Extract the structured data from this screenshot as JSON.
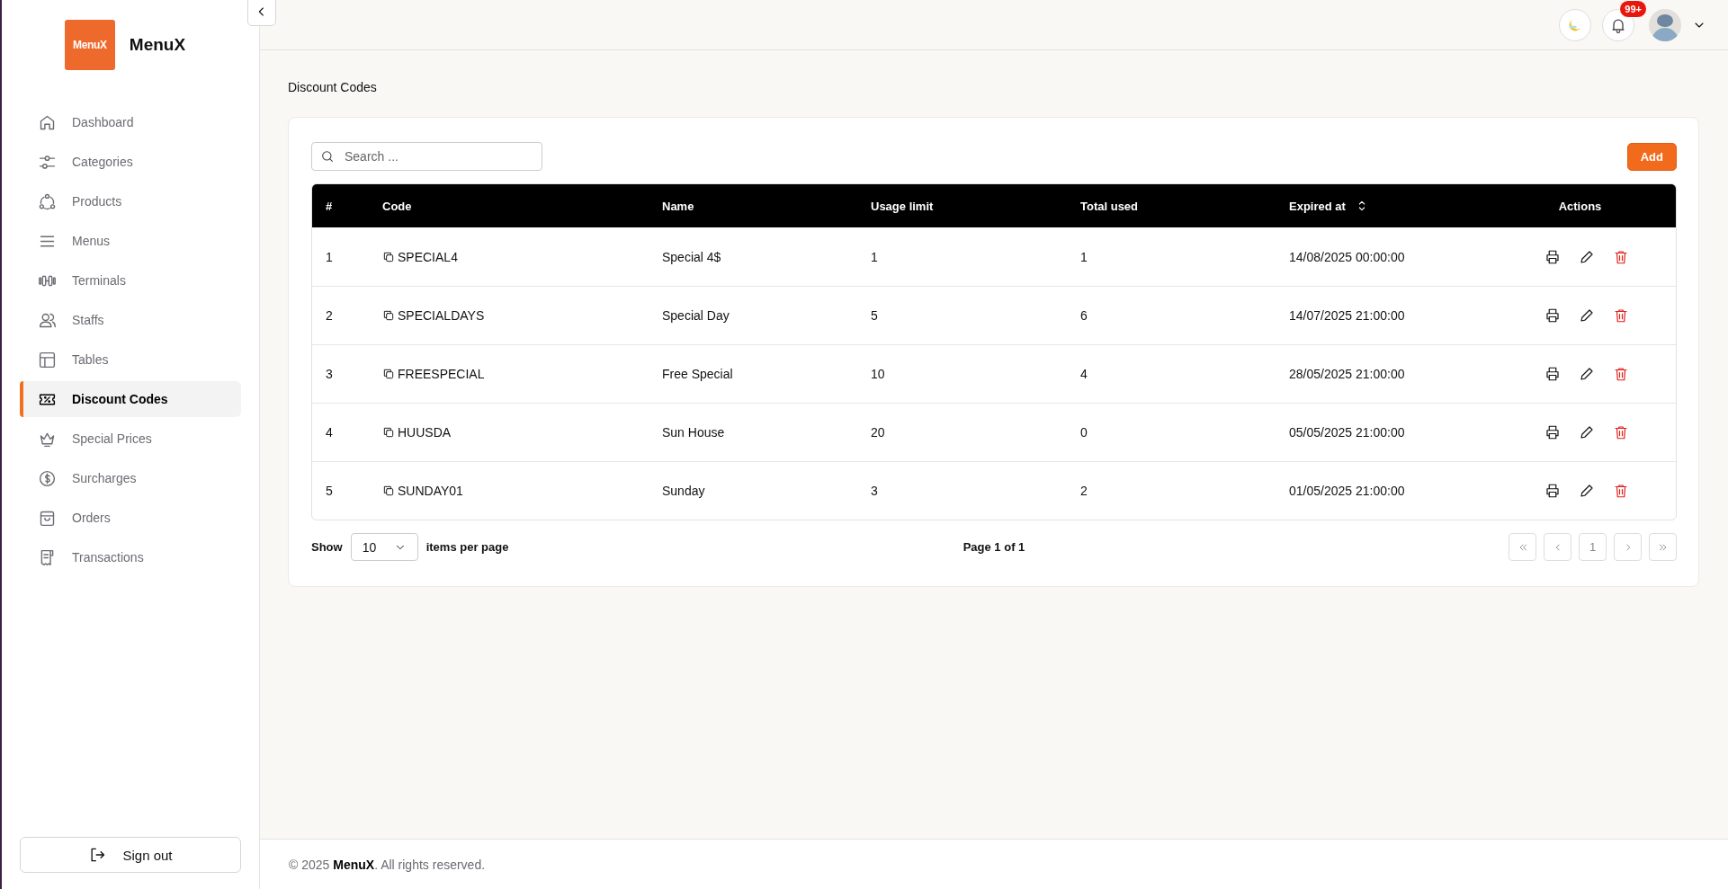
{
  "sidebar": {
    "logo_text": "MenuX",
    "brand": "MenuX",
    "items": [
      {
        "label": "Dashboard",
        "kind": "dashboard",
        "selected": false
      },
      {
        "label": "Categories",
        "kind": "categories",
        "selected": false
      },
      {
        "label": "Products",
        "kind": "products",
        "selected": false
      },
      {
        "label": "Menus",
        "kind": "menus",
        "selected": false
      },
      {
        "label": "Terminals",
        "kind": "terminals",
        "selected": false
      },
      {
        "label": "Staffs",
        "kind": "staffs",
        "selected": false
      },
      {
        "label": "Tables",
        "kind": "tables",
        "selected": false
      },
      {
        "label": "Discount Codes",
        "kind": "discounts",
        "selected": true
      },
      {
        "label": "Special Prices",
        "kind": "special",
        "selected": false
      },
      {
        "label": "Surcharges",
        "kind": "surcharges",
        "selected": false
      },
      {
        "label": "Orders",
        "kind": "orders",
        "selected": false
      },
      {
        "label": "Transactions",
        "kind": "transactions",
        "selected": false
      }
    ],
    "sign_out": "Sign out"
  },
  "topbar": {
    "notification_badge": "99+"
  },
  "page_title": "Discount Codes",
  "search": {
    "placeholder": "Search ..."
  },
  "add_button": "Add",
  "table": {
    "columns": [
      {
        "label": "#",
        "sortable": false
      },
      {
        "label": "Code",
        "sortable": false
      },
      {
        "label": "Name",
        "sortable": false
      },
      {
        "label": "Usage limit",
        "sortable": false
      },
      {
        "label": "Total used",
        "sortable": false
      },
      {
        "label": "Expired at",
        "sortable": true
      },
      {
        "label": "Actions",
        "sortable": false
      }
    ],
    "rows": [
      {
        "number": "1",
        "code": "SPECIAL4",
        "name": "Special 4$",
        "usage_limit": "1",
        "total_used": "1",
        "expired_at": "14/08/2025 00:00:00"
      },
      {
        "number": "2",
        "code": "SPECIALDAYS",
        "name": "Special Day",
        "usage_limit": "5",
        "total_used": "6",
        "expired_at": "14/07/2025 21:00:00"
      },
      {
        "number": "3",
        "code": "FREESPECIAL",
        "name": "Free Special",
        "usage_limit": "10",
        "total_used": "4",
        "expired_at": "28/05/2025 21:00:00"
      },
      {
        "number": "4",
        "code": "HUUSDA",
        "name": "Sun House",
        "usage_limit": "20",
        "total_used": "0",
        "expired_at": "05/05/2025 21:00:00"
      },
      {
        "number": "5",
        "code": "SUNDAY01",
        "name": "Sunday",
        "usage_limit": "3",
        "total_used": "2",
        "expired_at": "01/05/2025 21:00:00"
      }
    ]
  },
  "pagination": {
    "show_label": "Show",
    "page_size": "10",
    "per_page_label": "items per page",
    "page_info": "Page 1 of 1",
    "current_page": "1"
  },
  "footer": "© 2025 **MenuX**. All rights reserved."
}
